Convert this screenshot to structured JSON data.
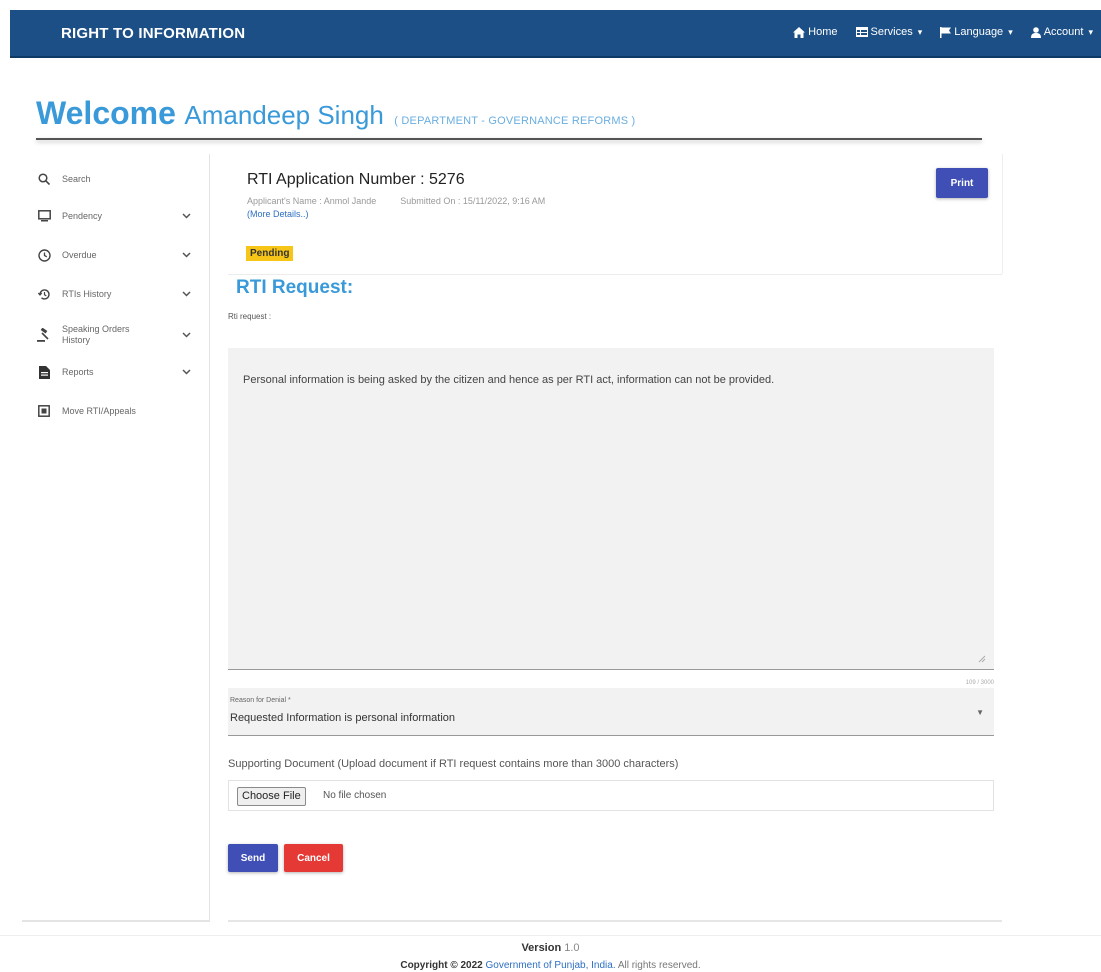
{
  "header": {
    "brand": "RIGHT TO INFORMATION",
    "nav": [
      {
        "label": "Home",
        "icon": "home-icon"
      },
      {
        "label": "Services",
        "icon": "table-icon"
      },
      {
        "label": "Language",
        "icon": "flag-icon"
      },
      {
        "label": "Account",
        "icon": "user-icon"
      }
    ],
    "bg_color": "#1b4f86"
  },
  "welcome": {
    "prefix": "Welcome",
    "name": "Amandeep Singh",
    "department": "( DEPARTMENT - GOVERNANCE REFORMS )"
  },
  "sidebar": {
    "items": [
      {
        "label": "Search",
        "icon": "search-icon"
      },
      {
        "label": "Pendency",
        "icon": "monitor-icon"
      },
      {
        "label": "Overdue",
        "icon": "clock-icon"
      },
      {
        "label": "RTIs History",
        "icon": "history-icon"
      },
      {
        "label": "Speaking Orders History",
        "icon": "gavel-icon"
      },
      {
        "label": "Reports",
        "icon": "file-icon"
      },
      {
        "label": "Move RTI/Appeals",
        "icon": "move-icon"
      }
    ]
  },
  "application": {
    "number_label": "RTI Application Number : 5276",
    "applicant": "Applicant's Name : Anmol Jande",
    "submitted": "Submitted On : 15/11/2022, 9:16 AM",
    "more_details": "(More Details..)",
    "status": "Pending",
    "print_label": "Print"
  },
  "request": {
    "title": "RTI Request:",
    "label": "Rti request :",
    "text": "Personal information is being asked by the citizen and hence as per RTI act, information can not be provided.",
    "counter": "109 / 3000"
  },
  "denial": {
    "label": "Reason for Denial *",
    "value": "Requested Information is personal information"
  },
  "support": {
    "label": "Supporting Document (Upload document if RTI request contains more than 3000 characters)",
    "choose_label": "Choose File",
    "no_file": "No file chosen"
  },
  "actions": {
    "send": "Send",
    "cancel": "Cancel"
  },
  "footer": {
    "version_label": "Version",
    "version_number": "1.0",
    "copyright_prefix": "Copyright © 2022",
    "gov_link": "Government of Punjab, India.",
    "rights": "All rights reserved."
  },
  "colors": {
    "accent": "#3a9ad9",
    "primary_button": "#3f4fb5",
    "danger_button": "#e53935",
    "badge": "#f6c517"
  }
}
